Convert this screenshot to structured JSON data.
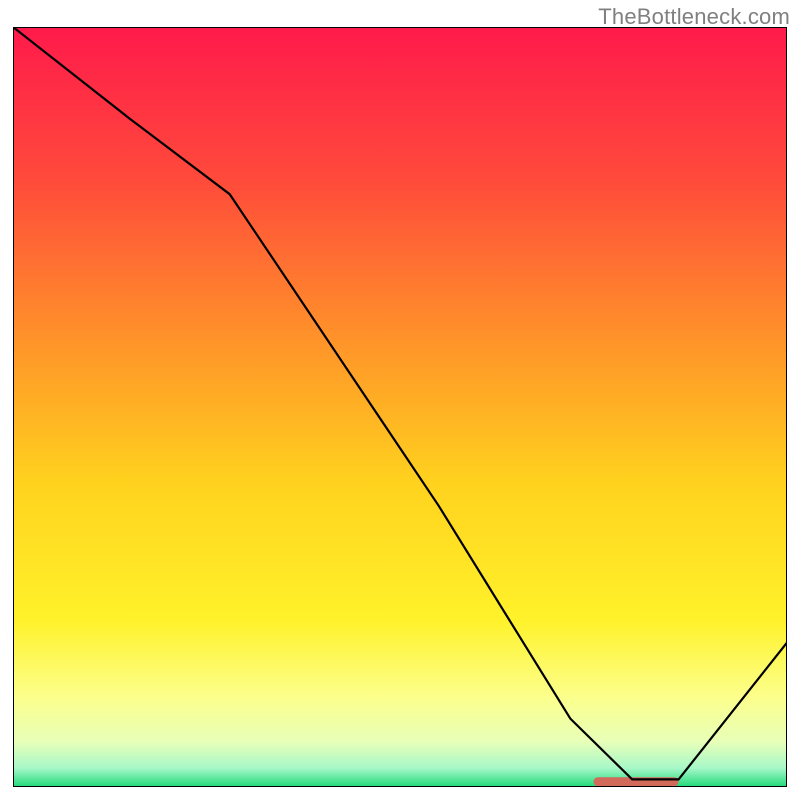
{
  "watermark": "TheBottleneck.com",
  "chart_data": {
    "type": "line",
    "title": "",
    "xlabel": "",
    "ylabel": "",
    "xlim": [
      0,
      100
    ],
    "ylim": [
      0,
      100
    ],
    "x": [
      0,
      15,
      28,
      55,
      72,
      80,
      86,
      100
    ],
    "values": [
      100,
      88,
      78,
      37,
      9,
      1,
      1,
      19
    ],
    "gradient_stops": [
      {
        "offset": 0.0,
        "color": "#ff1a4b"
      },
      {
        "offset": 0.2,
        "color": "#ff4a3b"
      },
      {
        "offset": 0.4,
        "color": "#ff8f2a"
      },
      {
        "offset": 0.6,
        "color": "#ffd21e"
      },
      {
        "offset": 0.78,
        "color": "#fff22a"
      },
      {
        "offset": 0.88,
        "color": "#fcff8a"
      },
      {
        "offset": 0.94,
        "color": "#e8ffb8"
      },
      {
        "offset": 0.975,
        "color": "#a8f8c8"
      },
      {
        "offset": 1.0,
        "color": "#1ed97a"
      }
    ],
    "marker": {
      "x_start": 75,
      "x_end": 86,
      "y": 0.7,
      "color": "#d26a5c"
    },
    "border_color": "#000000",
    "line_color": "#000000"
  }
}
